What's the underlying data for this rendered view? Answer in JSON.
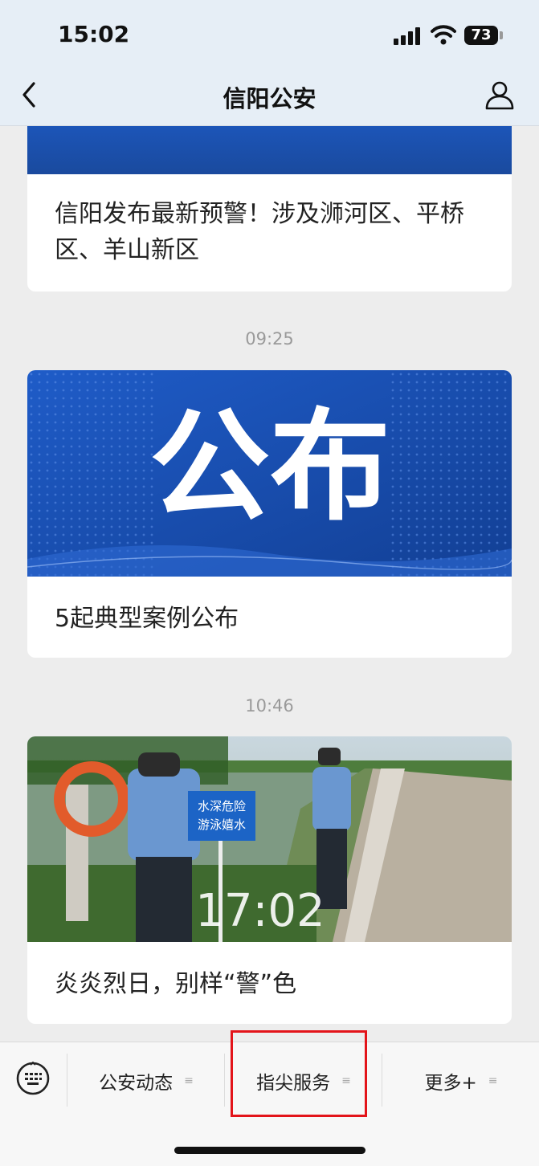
{
  "status_bar": {
    "time": "15:02",
    "battery": "73"
  },
  "header": {
    "title": "信阳公安"
  },
  "articles": [
    {
      "title": "信阳发布最新预警！涉及浉河区、平桥区、羊山新区"
    },
    {
      "time": "09:25",
      "image_text": "公布",
      "title": "5起典型案例公布"
    },
    {
      "time": "10:46",
      "image_overlay": "17:02",
      "sign_text_1": "水深危险",
      "sign_text_2": "游泳嬉水",
      "title": "炎炎烈日，别样“警”色"
    }
  ],
  "bottom_menu": {
    "items": [
      "公安动态",
      "指尖服务",
      "更多+"
    ]
  },
  "colors": {
    "highlight": "#e3141a",
    "banner_blue": "#1a4fb0"
  }
}
